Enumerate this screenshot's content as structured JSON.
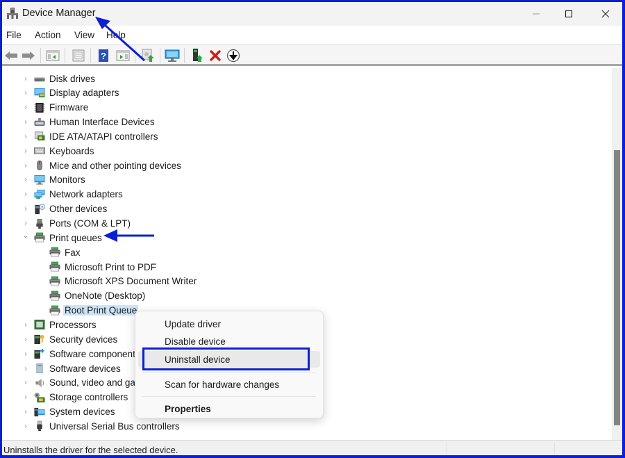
{
  "window": {
    "title": "Device Manager",
    "controls": {
      "minimize": "minimize",
      "maximize": "maximize",
      "close": "close"
    }
  },
  "menubar": {
    "items": [
      {
        "label": "File"
      },
      {
        "label": "Action"
      },
      {
        "label": "View"
      },
      {
        "label": "Help"
      }
    ]
  },
  "toolbar": {
    "buttons": [
      {
        "name": "back-icon",
        "tooltip": "Back"
      },
      {
        "name": "forward-icon",
        "tooltip": "Forward"
      },
      {
        "name": "show-hide-console-tree-icon",
        "tooltip": "Show/Hide Console Tree"
      },
      {
        "name": "properties-icon",
        "tooltip": "Properties"
      },
      {
        "name": "help-icon",
        "tooltip": "Help"
      },
      {
        "name": "show-hide-action-pane-icon",
        "tooltip": "Show/Hide Action Pane"
      },
      {
        "name": "update-driver-icon",
        "tooltip": "Update Driver"
      },
      {
        "name": "scan-hardware-icon",
        "tooltip": "Scan for hardware changes"
      },
      {
        "name": "add-driver-icon",
        "tooltip": "Add drivers"
      },
      {
        "name": "uninstall-icon",
        "tooltip": "Uninstall device"
      },
      {
        "name": "disable-device-icon",
        "tooltip": "Disable device"
      }
    ]
  },
  "tree": {
    "items": [
      {
        "label": "Disk drives",
        "icon": "disk-drive-icon",
        "expanded": false,
        "level": 0
      },
      {
        "label": "Display adapters",
        "icon": "display-adapter-icon",
        "expanded": false,
        "level": 0
      },
      {
        "label": "Firmware",
        "icon": "firmware-icon",
        "expanded": false,
        "level": 0
      },
      {
        "label": "Human Interface Devices",
        "icon": "hid-icon",
        "expanded": false,
        "level": 0
      },
      {
        "label": "IDE ATA/ATAPI controllers",
        "icon": "ide-controller-icon",
        "expanded": false,
        "level": 0
      },
      {
        "label": "Keyboards",
        "icon": "keyboard-icon",
        "expanded": false,
        "level": 0
      },
      {
        "label": "Mice and other pointing devices",
        "icon": "mouse-icon",
        "expanded": false,
        "level": 0
      },
      {
        "label": "Monitors",
        "icon": "monitor-icon",
        "expanded": false,
        "level": 0
      },
      {
        "label": "Network adapters",
        "icon": "network-adapter-icon",
        "expanded": false,
        "level": 0
      },
      {
        "label": "Other devices",
        "icon": "other-devices-icon",
        "expanded": false,
        "level": 0
      },
      {
        "label": "Ports (COM & LPT)",
        "icon": "port-icon",
        "expanded": false,
        "level": 0
      },
      {
        "label": "Print queues",
        "icon": "printer-icon",
        "expanded": true,
        "level": 0
      },
      {
        "label": "Fax",
        "icon": "printer-icon",
        "level": 1
      },
      {
        "label": "Microsoft Print to PDF",
        "icon": "printer-icon",
        "level": 1
      },
      {
        "label": "Microsoft XPS Document Writer",
        "icon": "printer-icon",
        "level": 1
      },
      {
        "label": "OneNote (Desktop)",
        "icon": "printer-icon",
        "level": 1
      },
      {
        "label": "Root Print Queue",
        "icon": "printer-icon",
        "level": 1,
        "selected": true
      },
      {
        "label": "Processors",
        "icon": "processor-icon",
        "expanded": false,
        "level": 0
      },
      {
        "label": "Security devices",
        "icon": "security-device-icon",
        "expanded": false,
        "level": 0
      },
      {
        "label": "Software components",
        "icon": "software-component-icon",
        "expanded": false,
        "level": 0
      },
      {
        "label": "Software devices",
        "icon": "software-device-icon",
        "expanded": false,
        "level": 0
      },
      {
        "label": "Sound, video and game controllers",
        "icon": "sound-icon",
        "expanded": false,
        "level": 0
      },
      {
        "label": "Storage controllers",
        "icon": "storage-controller-icon",
        "expanded": false,
        "level": 0
      },
      {
        "label": "System devices",
        "icon": "system-devices-icon",
        "expanded": false,
        "level": 0
      },
      {
        "label": "Universal Serial Bus controllers",
        "icon": "usb-icon",
        "expanded": false,
        "level": 0
      }
    ]
  },
  "scrollbar": {
    "thumb_start_fraction": 0.22,
    "thumb_size_fraction": 0.74
  },
  "context_menu": {
    "items": [
      {
        "label": "Update driver"
      },
      {
        "label": "Disable device"
      },
      {
        "label": "Uninstall device",
        "hovered": true,
        "highlighted": true
      },
      {
        "label": "Scan for hardware changes"
      },
      {
        "label": "Properties",
        "bold": true
      }
    ]
  },
  "statusbar": {
    "text": "Uninstalls the driver for the selected device."
  },
  "colors": {
    "annotation": "#0a1fd6",
    "selection": "#cce4f7",
    "uninstall_red": "#d81818"
  }
}
